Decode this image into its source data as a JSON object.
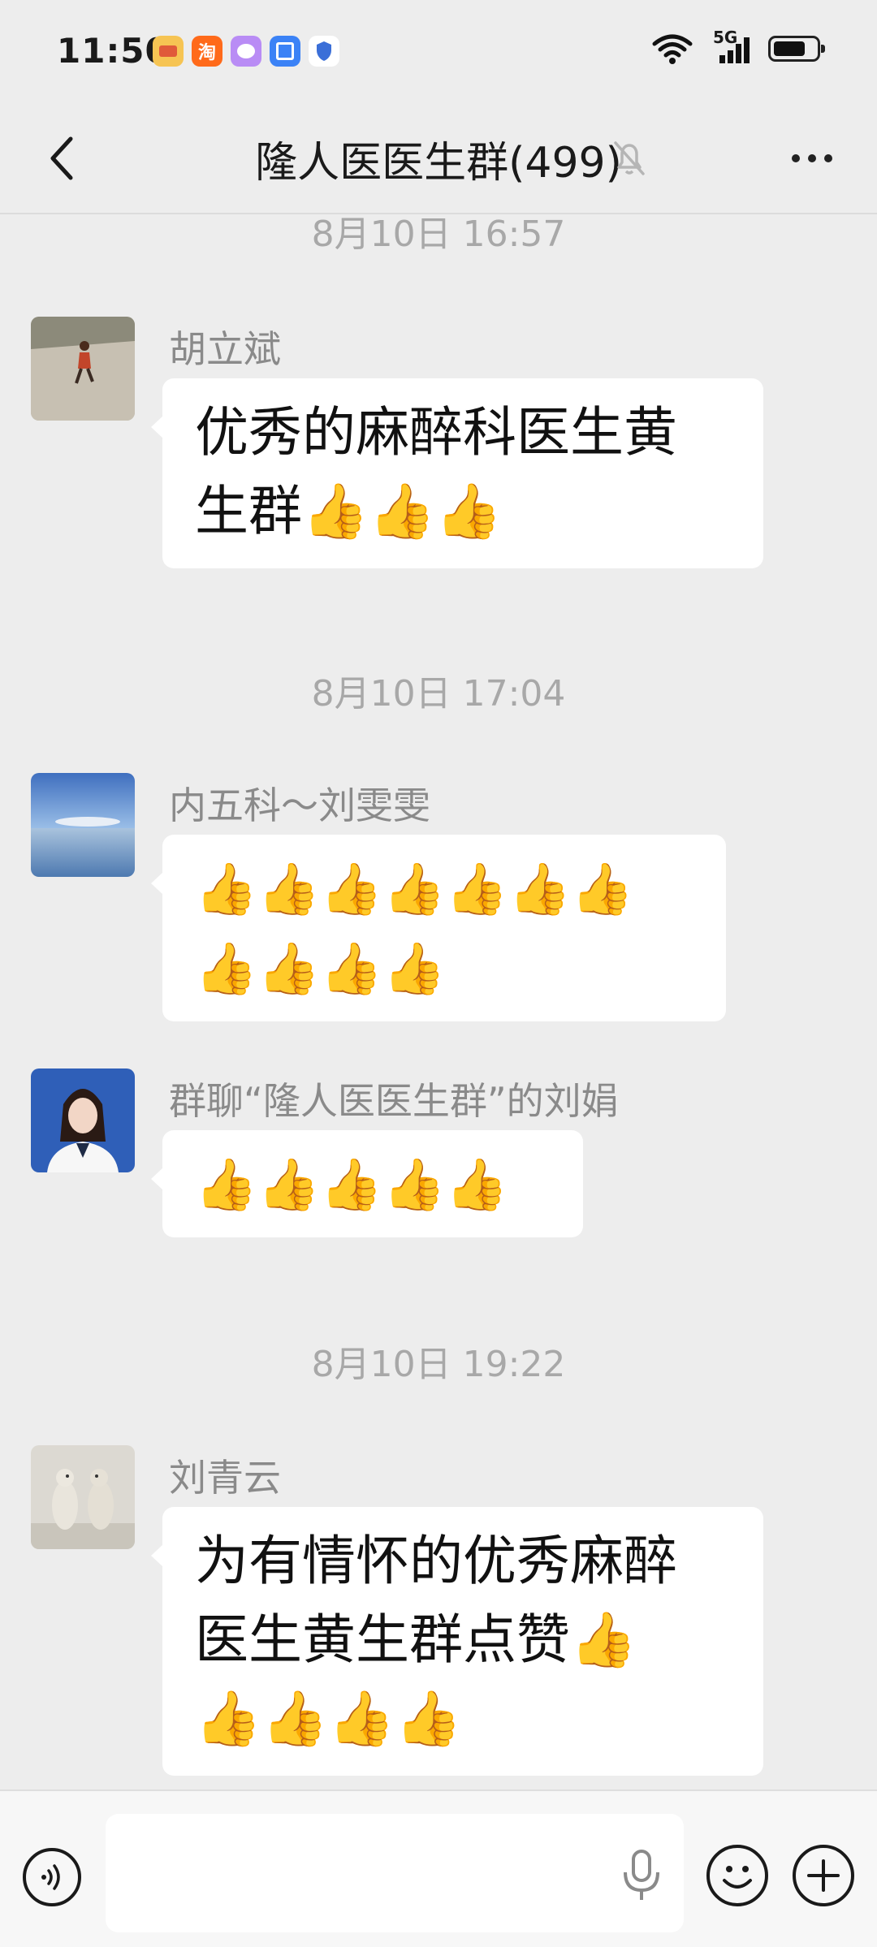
{
  "status_bar": {
    "time": "11:50",
    "network": "5G",
    "apps": [
      {
        "name": "wallet-app-icon",
        "glyph": "",
        "color": "#f6c453"
      },
      {
        "name": "taobao-app-icon",
        "glyph": "淘",
        "color": "#ff6a1a"
      },
      {
        "name": "chat-app-icon",
        "glyph": "",
        "color": "#c9a4ff"
      },
      {
        "name": "app-market-icon",
        "glyph": "",
        "color": "#3b82f6"
      },
      {
        "name": "security-app-icon",
        "glyph": "",
        "color": "#ffffff"
      }
    ]
  },
  "header": {
    "title": "隆人医医生群(499)"
  },
  "messages": [
    {
      "type": "time",
      "text": "8月10日 16:57"
    },
    {
      "type": "msg",
      "sender": "胡立斌",
      "avatar": "runner-avatar",
      "lines": [
        "优秀的麻醉科医生黄",
        "生群👍👍👍"
      ],
      "style": "text"
    },
    {
      "type": "time",
      "text": "8月10日 17:04"
    },
    {
      "type": "msg",
      "sender": "内五科～刘雯雯",
      "avatar": "lake-avatar",
      "lines": [
        "👍👍👍👍👍👍👍",
        "👍👍👍👍"
      ],
      "style": "emoji"
    },
    {
      "type": "msg",
      "sender": "群聊“隆人医医生群”的刘娟",
      "avatar": "doctor-avatar",
      "lines": [
        "👍👍👍👍👍"
      ],
      "style": "emoji"
    },
    {
      "type": "time",
      "text": "8月10日 19:22"
    },
    {
      "type": "msg",
      "sender": "刘青云",
      "avatar": "polar-bears-avatar",
      "lines": [
        "为有情怀的优秀麻醉",
        "医生黄生群点赞👍",
        "👍👍👍👍"
      ],
      "style": "text"
    }
  ],
  "input": {
    "placeholder": ""
  },
  "colors": {
    "background": "#ededed",
    "bubble": "#ffffff",
    "timestamp": "#a8a8a8",
    "sender": "#8a8a8a"
  }
}
